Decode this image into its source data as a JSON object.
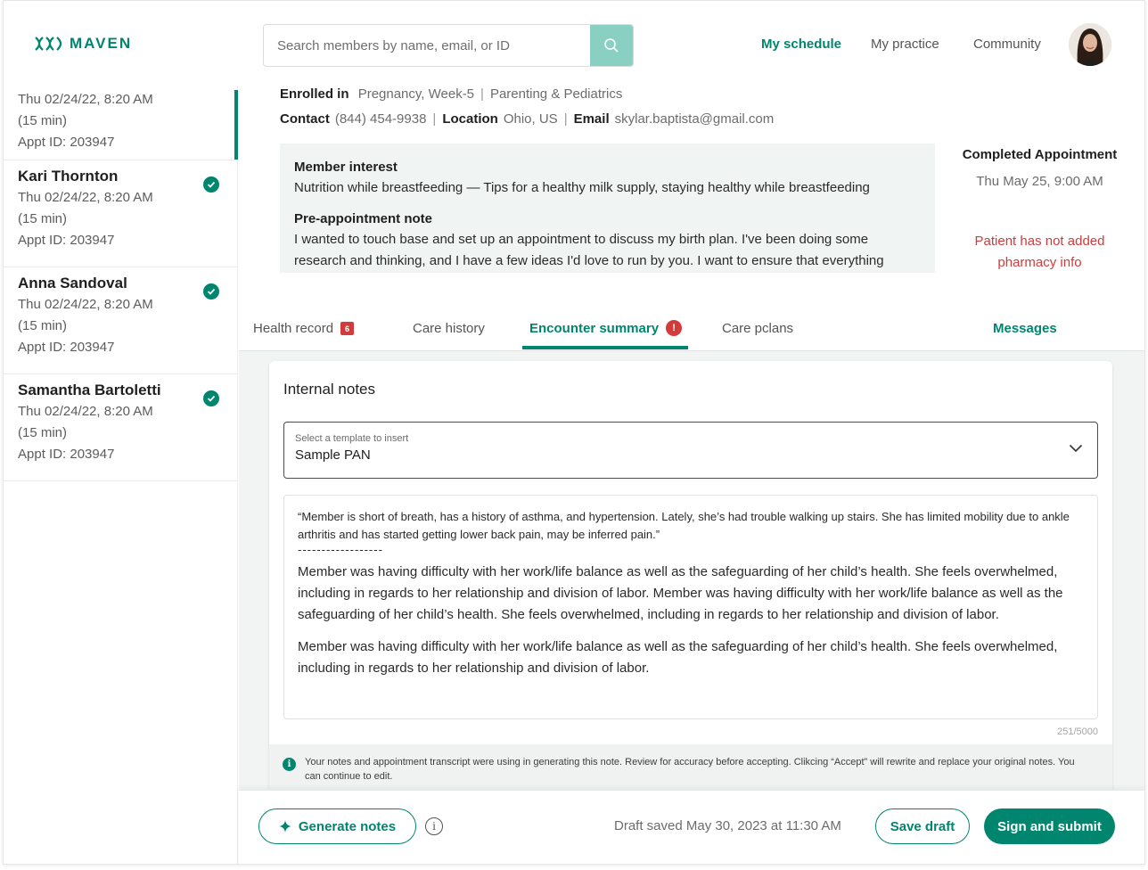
{
  "header": {
    "logo_text": "MAVEN",
    "search_placeholder": "Search members by name, email, or ID",
    "nav": [
      "My schedule",
      "My practice",
      "Community"
    ]
  },
  "sidebar": {
    "items": [
      {
        "name": "",
        "date": "Thu 02/24/22, 8:20 AM",
        "duration": "(15 min)",
        "appt": "Appt ID: 203947",
        "completed": false,
        "active": true
      },
      {
        "name": "Kari Thornton",
        "date": "Thu 02/24/22, 8:20 AM",
        "duration": "(15 min)",
        "appt": "Appt ID: 203947",
        "completed": true,
        "active": false
      },
      {
        "name": "Anna Sandoval",
        "date": "Thu 02/24/22, 8:20 AM",
        "duration": "(15 min)",
        "appt": "Appt ID: 203947",
        "completed": true,
        "active": false
      },
      {
        "name": "Samantha Bartoletti",
        "date": "Thu 02/24/22, 8:20 AM",
        "duration": "(15 min)",
        "appt": "Appt ID: 203947",
        "completed": true,
        "active": false
      }
    ]
  },
  "member": {
    "enrolled_label": "Enrolled in",
    "enrolled_1": "Pregnancy, Week-5",
    "enrolled_2": "Parenting & Pediatrics",
    "contact_label": "Contact",
    "contact": "(844) 454-9938",
    "location_label": "Location",
    "location": "Ohio, US",
    "email_label": "Email",
    "email": "skylar.baptista@gmail.com",
    "interest_heading": "Member interest",
    "interest_text": "Nutrition while breastfeeding — Tips for a healthy milk supply, staying healthy while breastfeeding",
    "pre_note_heading": "Pre-appointment note",
    "pre_note_text": "I wanted to touch base and set up an appointment to discuss my birth plan. I've been doing some research and thinking, and I have a few ideas I'd love to run by you. I want to ensure that everything",
    "completed_title": "Completed Appointment",
    "completed_date": "Thu May 25, 9:00 AM",
    "pharmacy_warning_1": "Patient has not added",
    "pharmacy_warning_2": "pharmacy info"
  },
  "tabs": [
    {
      "label": "Health record",
      "badge": "6"
    },
    {
      "label": "Care history"
    },
    {
      "label": "Encounter summary",
      "alert": "!"
    },
    {
      "label": "Care pclans"
    },
    {
      "label": "Messages"
    }
  ],
  "notes": {
    "title": "Internal notes",
    "select_label": "Select a template to insert",
    "select_value": "Sample PAN",
    "quote": "“Member is short of breath, has a history of asthma, and hypertension. Lately, she’s had trouble walking up stairs. She has limited mobility due to ankle arthritis and has started getting lower back pain, may be inferred pain.”",
    "divider": "------------------",
    "para_1": "Member was having difficulty with her work/life balance as well as the safeguarding of her child’s health. She feels overwhelmed, including in regards to her relationship and division of labor. Member was having difficulty with her work/life balance as well as the safeguarding of her child’s health. She feels overwhelmed, including in regards to her relationship and division of labor.",
    "para_2": "Member was having difficulty with her work/life balance as well as the safeguarding of her child’s health. She feels overwhelmed, including in regards to her relationship and division of labor.",
    "counter": "251/5000",
    "disclaimer": "Your notes and appointment transcript were using in generating this note. Review for accuracy before accepting. Clikcing “Accept” will rewrite and replace your original notes. You can continue to edit."
  },
  "footer": {
    "generate_label": "Generate notes",
    "draft_status": "Draft saved May 30, 2023 at 11:30 AM",
    "save_label": "Save draft",
    "submit_label": "Sign and submit"
  },
  "colors": {
    "accent": "#00856f",
    "warning": "#d03b3b",
    "search_button": "#8ad0c2"
  }
}
